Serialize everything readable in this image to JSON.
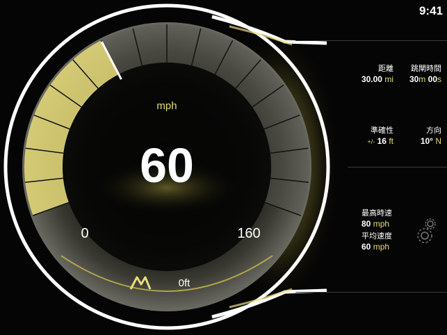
{
  "status_bar": {
    "time": "9:41"
  },
  "gauge": {
    "value": 60,
    "value_text": "60",
    "unit": "mph",
    "min": 0,
    "max": 160,
    "min_label": "0",
    "max_label": "160",
    "altitude": "0ft",
    "accent_color": "#e8dc7a"
  },
  "stats": {
    "distance": {
      "label": "距離",
      "value": "30.00",
      "unit": "mi"
    },
    "elapsed": {
      "label": "跳閘時間",
      "min_value": "30",
      "min_unit": "m",
      "sec_value": "00",
      "sec_unit": "s"
    },
    "accuracy": {
      "label": "準確性",
      "prefix": "+/-",
      "value": "16",
      "unit": "ft"
    },
    "heading": {
      "label": "方向",
      "value": "10°",
      "unit": "N"
    },
    "top_speed": {
      "label": "最高時速",
      "value": "80",
      "unit": "mph"
    },
    "avg_speed": {
      "label": "平均速度",
      "value": "60",
      "unit": "mph"
    }
  },
  "icons": {
    "mountain": "mountain-icon",
    "settings": "gear-icon"
  }
}
